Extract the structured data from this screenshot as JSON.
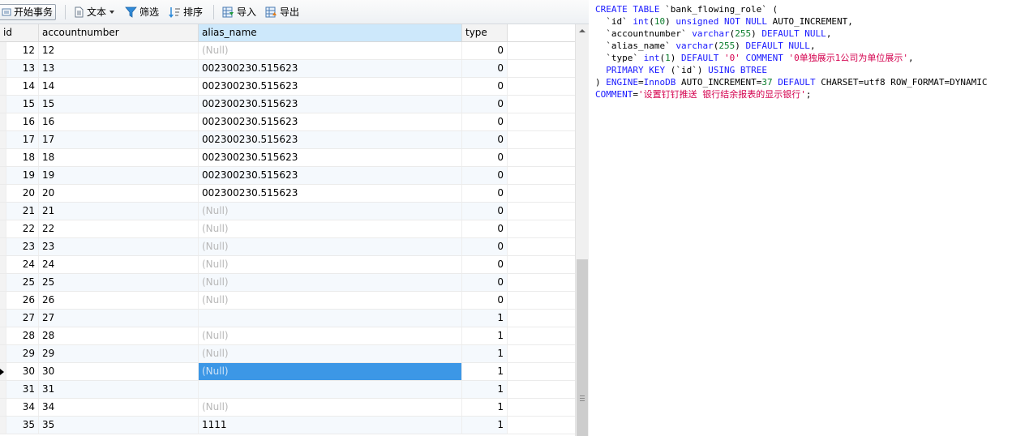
{
  "toolbar": {
    "begin_transaction": "开始事务",
    "text": "文本",
    "filter": "筛选",
    "sort": "排序",
    "import": "导入",
    "export": "导出"
  },
  "grid": {
    "columns": [
      "id",
      "accountnumber",
      "alias_name",
      "type"
    ],
    "selected_column": "alias_name",
    "rows": [
      {
        "id": "12",
        "accountnumber": "12",
        "alias_name": "(Null)",
        "alias_null": true,
        "type": "0"
      },
      {
        "id": "13",
        "accountnumber": "13",
        "alias_name": "002300230.515623",
        "alias_null": false,
        "type": "0"
      },
      {
        "id": "14",
        "accountnumber": "14",
        "alias_name": "002300230.515623",
        "alias_null": false,
        "type": "0"
      },
      {
        "id": "15",
        "accountnumber": "15",
        "alias_name": "002300230.515623",
        "alias_null": false,
        "type": "0"
      },
      {
        "id": "16",
        "accountnumber": "16",
        "alias_name": "002300230.515623",
        "alias_null": false,
        "type": "0"
      },
      {
        "id": "17",
        "accountnumber": "17",
        "alias_name": "002300230.515623",
        "alias_null": false,
        "type": "0"
      },
      {
        "id": "18",
        "accountnumber": "18",
        "alias_name": "002300230.515623",
        "alias_null": false,
        "type": "0"
      },
      {
        "id": "19",
        "accountnumber": "19",
        "alias_name": "002300230.515623",
        "alias_null": false,
        "type": "0"
      },
      {
        "id": "20",
        "accountnumber": "20",
        "alias_name": "002300230.515623",
        "alias_null": false,
        "type": "0"
      },
      {
        "id": "21",
        "accountnumber": "21",
        "alias_name": "(Null)",
        "alias_null": true,
        "type": "0"
      },
      {
        "id": "22",
        "accountnumber": "22",
        "alias_name": "(Null)",
        "alias_null": true,
        "type": "0"
      },
      {
        "id": "23",
        "accountnumber": "23",
        "alias_name": "(Null)",
        "alias_null": true,
        "type": "0"
      },
      {
        "id": "24",
        "accountnumber": "24",
        "alias_name": "(Null)",
        "alias_null": true,
        "type": "0"
      },
      {
        "id": "25",
        "accountnumber": "25",
        "alias_name": "(Null)",
        "alias_null": true,
        "type": "0"
      },
      {
        "id": "26",
        "accountnumber": "26",
        "alias_name": "(Null)",
        "alias_null": true,
        "type": "0"
      },
      {
        "id": "27",
        "accountnumber": "27",
        "alias_name": "",
        "alias_null": false,
        "type": "1"
      },
      {
        "id": "28",
        "accountnumber": "28",
        "alias_name": "(Null)",
        "alias_null": true,
        "type": "1"
      },
      {
        "id": "29",
        "accountnumber": "29",
        "alias_name": "(Null)",
        "alias_null": true,
        "type": "1"
      },
      {
        "id": "30",
        "accountnumber": "30",
        "alias_name": "(Null)",
        "alias_null": true,
        "type": "1",
        "current": true
      },
      {
        "id": "31",
        "accountnumber": "31",
        "alias_name": "",
        "alias_null": false,
        "type": "1"
      },
      {
        "id": "34",
        "accountnumber": "34",
        "alias_name": "(Null)",
        "alias_null": true,
        "type": "1"
      },
      {
        "id": "35",
        "accountnumber": "35",
        "alias_name": "1111",
        "alias_null": false,
        "type": "1"
      }
    ]
  },
  "ddl": {
    "lines": [
      [
        [
          "kw",
          "CREATE TABLE "
        ],
        [
          "t",
          "`bank_flowing_role` ("
        ]
      ],
      [
        [
          "t",
          "  `id` "
        ],
        [
          "kw",
          "int"
        ],
        [
          "t",
          "("
        ],
        [
          "num",
          "10"
        ],
        [
          "t",
          ") "
        ],
        [
          "kw",
          "unsigned NOT NULL"
        ],
        [
          "t",
          " AUTO_INCREMENT,"
        ]
      ],
      [
        [
          "t",
          "  `accountnumber` "
        ],
        [
          "kw",
          "varchar"
        ],
        [
          "t",
          "("
        ],
        [
          "num",
          "255"
        ],
        [
          "t",
          ") "
        ],
        [
          "kw",
          "DEFAULT NULL"
        ],
        [
          "t",
          ","
        ]
      ],
      [
        [
          "t",
          "  `alias_name` "
        ],
        [
          "kw",
          "varchar"
        ],
        [
          "t",
          "("
        ],
        [
          "num",
          "255"
        ],
        [
          "t",
          ") "
        ],
        [
          "kw",
          "DEFAULT NULL"
        ],
        [
          "t",
          ","
        ]
      ],
      [
        [
          "t",
          "  `type` "
        ],
        [
          "kw",
          "int"
        ],
        [
          "t",
          "("
        ],
        [
          "num",
          "1"
        ],
        [
          "t",
          ") "
        ],
        [
          "kw",
          "DEFAULT "
        ],
        [
          "str",
          "'0'"
        ],
        [
          "t",
          " "
        ],
        [
          "kw",
          "COMMENT "
        ],
        [
          "str",
          "'0单独展示1公司为单位展示'"
        ],
        [
          "t",
          ","
        ]
      ],
      [
        [
          "t",
          "  "
        ],
        [
          "kw",
          "PRIMARY KEY"
        ],
        [
          "t",
          " (`id`) "
        ],
        [
          "kw",
          "USING BTREE"
        ]
      ],
      [
        [
          "t",
          ") "
        ],
        [
          "kw",
          "ENGINE"
        ],
        [
          "t",
          "="
        ],
        [
          "kw",
          "InnoDB"
        ],
        [
          "t",
          " AUTO_INCREMENT="
        ],
        [
          "num",
          "37"
        ],
        [
          "t",
          " "
        ],
        [
          "kw",
          "DEFAULT"
        ],
        [
          "t",
          " CHARSET=utf8 ROW_FORMAT=DYNAMIC"
        ]
      ],
      [
        [
          "kw",
          "COMMENT"
        ],
        [
          "t",
          "="
        ],
        [
          "str",
          "'设置钉钉推送 银行结余报表的显示银行'"
        ],
        [
          "t",
          ";"
        ]
      ]
    ]
  }
}
